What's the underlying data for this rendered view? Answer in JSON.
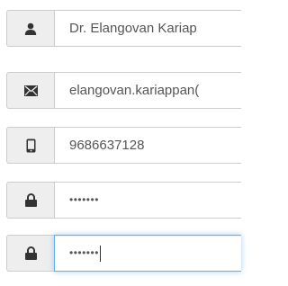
{
  "form": {
    "name": {
      "icon": "user-icon",
      "value": "Dr. Elangovan Kariap"
    },
    "email": {
      "icon": "envelope-icon",
      "value": "elangovan.kariappan("
    },
    "phone": {
      "icon": "mobile-phone-icon",
      "value": "9686637128"
    },
    "password": {
      "icon": "lock-icon",
      "value": "•••••••"
    },
    "confirm_password": {
      "icon": "lock-icon",
      "value": "•••••••",
      "focused": true
    }
  },
  "colors": {
    "addon_background": "#eeeeee",
    "border": "#cccccc",
    "focus_border": "#66afe9",
    "text": "#555555",
    "icon": "#333333"
  }
}
